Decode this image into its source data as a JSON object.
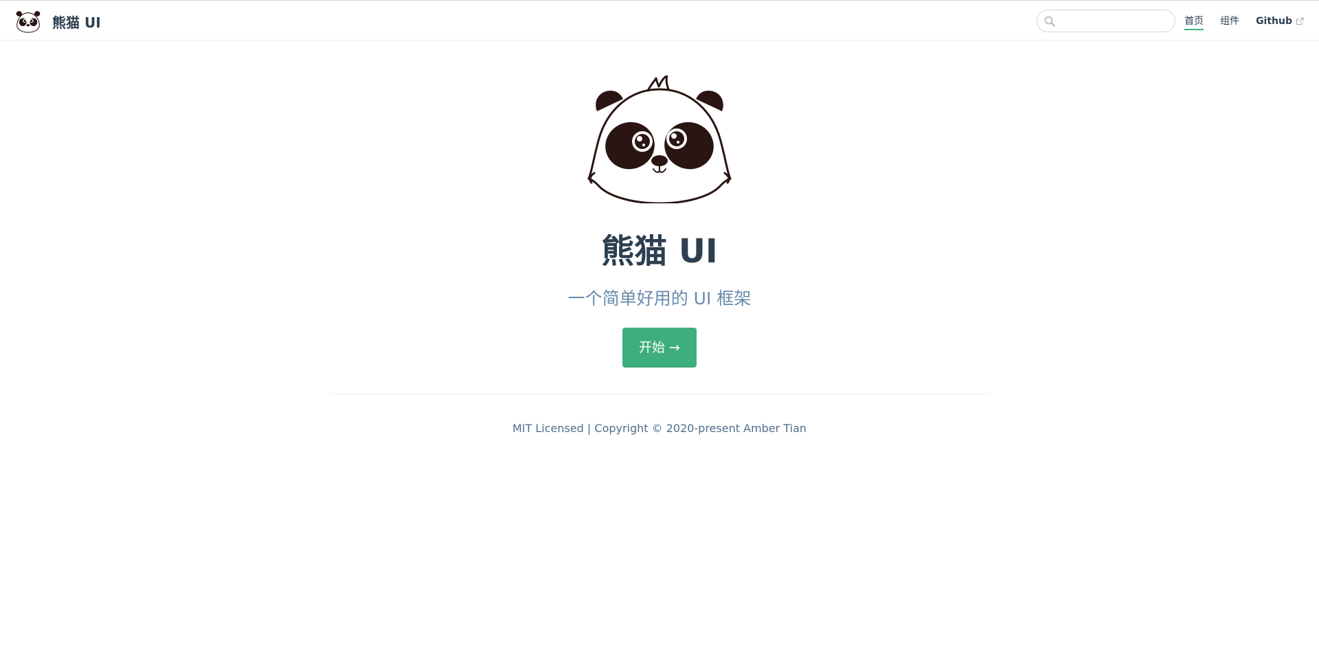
{
  "navbar": {
    "site_title": "熊猫 UI",
    "logo_icon": "panda-logo-icon",
    "search": {
      "value": "",
      "placeholder": "",
      "icon": "search-icon"
    },
    "links": [
      {
        "label": "首页",
        "active": true
      },
      {
        "label": "组件",
        "active": false
      },
      {
        "label": "Github",
        "external": true,
        "icon": "external-link-icon"
      }
    ]
  },
  "hero": {
    "image_icon": "panda-face-icon",
    "title": "熊猫 UI",
    "tagline": "一个简单好用的 UI 框架",
    "action_label": "开始 →"
  },
  "footer": {
    "text": "MIT Licensed | Copyright © 2020-present Amber Tian"
  },
  "colors": {
    "accent": "#3eaf7c",
    "text": "#2c3e50",
    "tagline": "#6a8bad",
    "panda_dark": "#2a1512"
  }
}
